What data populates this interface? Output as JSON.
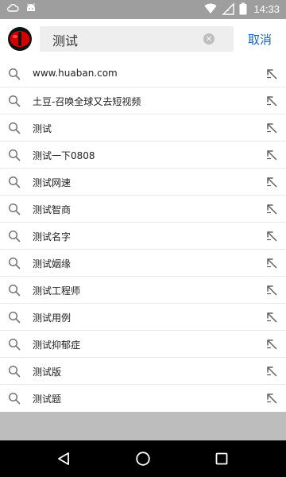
{
  "status_bar": {
    "time": "14:33",
    "icons": [
      "cloud-icon",
      "android-icon",
      "wifi-icon",
      "no-sim-icon",
      "battery-icon"
    ]
  },
  "search": {
    "query": "测试",
    "cancel_label": "取消"
  },
  "suggestions": [
    {
      "text": "www.huaban.com"
    },
    {
      "text": "土豆-召唤全球又去短视频"
    },
    {
      "text": "测试"
    },
    {
      "text": "测试一下0808"
    },
    {
      "text": "测试网速"
    },
    {
      "text": "测试智商"
    },
    {
      "text": "测试名字"
    },
    {
      "text": "测试姻缘"
    },
    {
      "text": "测试工程师"
    },
    {
      "text": "测试用例"
    },
    {
      "text": "测试抑郁症"
    },
    {
      "text": "测试版"
    },
    {
      "text": "测试题"
    }
  ],
  "colors": {
    "status_bar_bg": "#9e9e9e",
    "accent": "#1565c0",
    "logo_red": "#d50000",
    "nav_bar_bg": "#000000"
  }
}
